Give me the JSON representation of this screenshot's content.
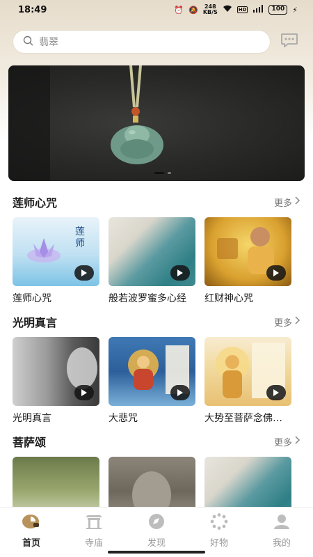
{
  "status": {
    "time": "18:49",
    "net_speed_top": "248",
    "net_speed_bottom": "KB/S",
    "battery": "100"
  },
  "search": {
    "placeholder": "翡翠"
  },
  "banner": {
    "image": "jade-buddha-pendant",
    "pages": 2,
    "active_page": 1
  },
  "sections": [
    {
      "title": "莲师心咒",
      "more": "更多",
      "items": [
        {
          "title": "莲师心咒"
        },
        {
          "title": "般若波罗蜜多心经"
        },
        {
          "title": "红财神心咒"
        }
      ]
    },
    {
      "title": "光明真言",
      "more": "更多",
      "items": [
        {
          "title": "光明真言"
        },
        {
          "title": "大悲咒"
        },
        {
          "title": "大势至菩萨念佛圆通章"
        }
      ]
    },
    {
      "title": "菩萨颂",
      "more": "更多",
      "items": [
        {
          "title": ""
        },
        {
          "title": ""
        },
        {
          "title": ""
        }
      ]
    }
  ],
  "tabs": [
    {
      "label": "首页",
      "icon": "home-icon",
      "active": true
    },
    {
      "label": "寺庙",
      "icon": "temple-icon",
      "active": false
    },
    {
      "label": "发现",
      "icon": "compass-icon",
      "active": false
    },
    {
      "label": "好物",
      "icon": "beads-icon",
      "active": false
    },
    {
      "label": "我的",
      "icon": "profile-icon",
      "active": false
    }
  ],
  "colors": {
    "accent": "#b8925a",
    "inactive_tab": "#9a9a9a",
    "header_gradient": "#e6dccb"
  }
}
